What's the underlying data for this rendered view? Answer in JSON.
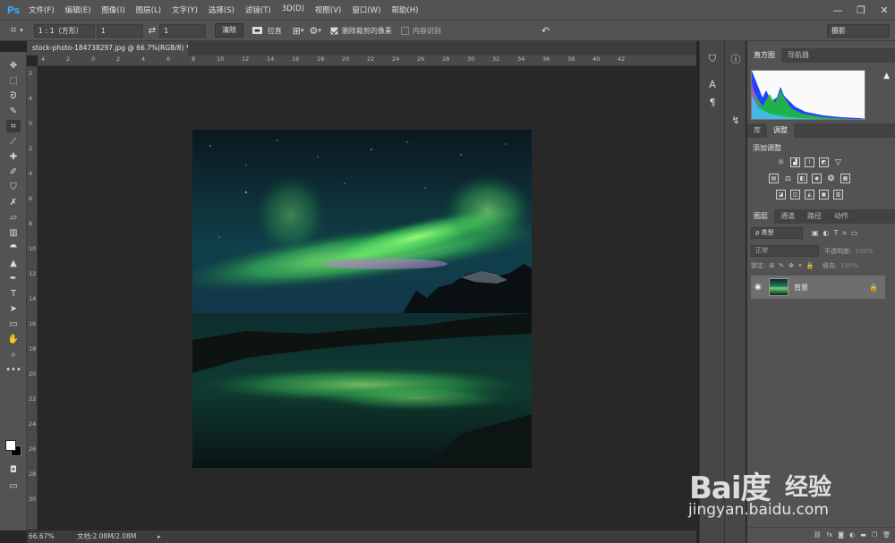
{
  "app": {
    "logo": "Ps"
  },
  "menu": [
    "文件(F)",
    "编辑(E)",
    "图像(I)",
    "图层(L)",
    "文字(Y)",
    "选择(S)",
    "滤镜(T)",
    "3D(D)",
    "视图(V)",
    "窗口(W)",
    "帮助(H)"
  ],
  "window_controls": [
    "—",
    "❐",
    "✕"
  ],
  "options": {
    "ratio": "1 : 1（方形）",
    "width_value": "1",
    "height_value": "1",
    "clear_label": "清除",
    "straighten_label": "拉直",
    "delete_cropped": {
      "label": "删除裁剪的像素",
      "checked": true
    },
    "content_aware": {
      "label": "内容识别",
      "checked": false
    },
    "workspace": "摄影"
  },
  "document": {
    "tab_title": "stock-photo-184738297.jpg @ 66.7%(RGB/8) *",
    "ruler_h_ticks": [
      "4",
      "2",
      "0",
      "2",
      "4",
      "6",
      "8",
      "10",
      "12",
      "14",
      "16",
      "18",
      "20",
      "22",
      "24",
      "26",
      "28",
      "30",
      "32",
      "34",
      "36",
      "38",
      "40",
      "42"
    ],
    "ruler_v_ticks": [
      "2",
      "4",
      "0",
      "2",
      "4",
      "6",
      "8",
      "10",
      "12",
      "14",
      "16",
      "18",
      "20",
      "22",
      "24",
      "26",
      "28",
      "30"
    ],
    "zoom": "66.67%",
    "doc_size": "文档:2.08M/2.08M"
  },
  "panels": {
    "top_tabs": [
      "直方图",
      "导航器"
    ],
    "mid_tabs": [
      "库",
      "调整"
    ],
    "adjust_title": "添加调整",
    "layer_tabs": [
      "图层",
      "通道",
      "路径",
      "动作"
    ],
    "filter_label": "ρ 类型",
    "blend_mode": "正常",
    "opacity_label": "不透明度:",
    "opacity_value": "100%",
    "lock_label": "锁定:",
    "fill_label": "填充:",
    "fill_value": "100%",
    "layer_name": "背景"
  },
  "watermark": {
    "logo": "Bai度",
    "cn": "经验",
    "url": "jingyan.baidu.com"
  },
  "colors": {
    "ps_blue": "#31a8ff",
    "ui_bg": "#535353",
    "canvas_bg": "#282828"
  }
}
